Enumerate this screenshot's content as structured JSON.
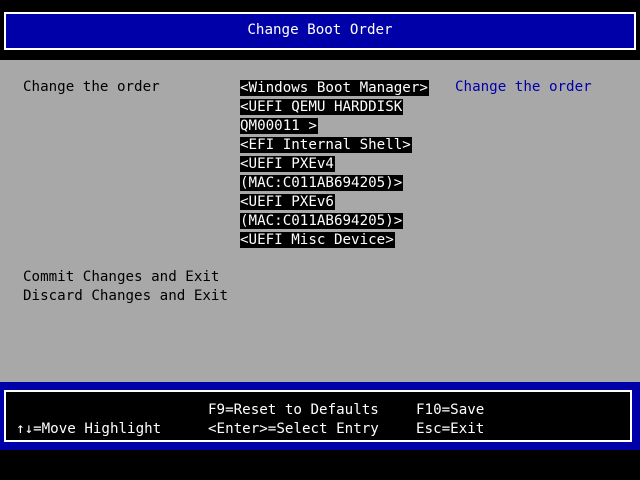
{
  "header": {
    "title": "Change Boot Order"
  },
  "main": {
    "order_label": "Change the order",
    "help_text": "Change the order",
    "boot_entries": [
      "<Windows Boot Manager>",
      "<UEFI QEMU HARDDISK",
      "QM00011 >",
      "<EFI Internal Shell>",
      "<UEFI PXEv4",
      "(MAC:C011AB694205)>",
      "<UEFI PXEv6",
      "(MAC:C011AB694205)>",
      "<UEFI Misc Device>"
    ],
    "commit_label": "Commit Changes and Exit",
    "discard_label": "Discard Changes and Exit"
  },
  "footer": {
    "move_highlight": "↑↓=Move Highlight",
    "reset_defaults": "F9=Reset to Defaults",
    "select_entry": "<Enter>=Select Entry",
    "save": "F10=Save",
    "exit": "Esc=Exit"
  },
  "colors": {
    "background": "#a8a8a8",
    "title_bar": "#0000a8",
    "help_text": "#0000a8",
    "highlight_bg": "#000000",
    "highlight_fg": "#ffffff"
  }
}
